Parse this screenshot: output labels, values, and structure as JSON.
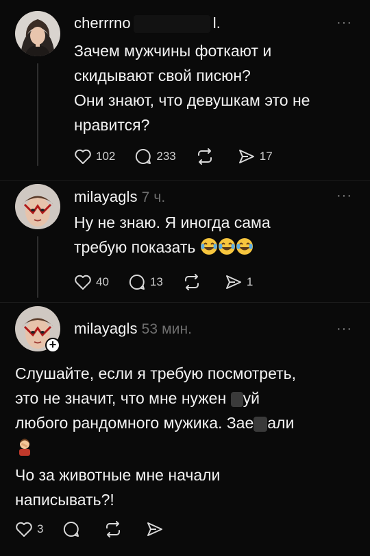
{
  "post1": {
    "username": "cherrrno",
    "username_tail": "l.",
    "text_lines": [
      "Зачем мужчины фоткают и",
      "скидывают свой писюн?",
      "Они знают, что девушкам это не",
      "нравится?"
    ],
    "likes": "102",
    "comments": "233",
    "shares": "17",
    "more": "···"
  },
  "post2": {
    "username": "milayagls",
    "time": "7 ч.",
    "text_lines": [
      "Ну не знаю. Я иногда сама",
      "требую показать"
    ],
    "likes": "40",
    "comments": "13",
    "shares": "1",
    "more": "···"
  },
  "post3": {
    "username": "milayagls",
    "time": "53 мин.",
    "text_lines": [
      "Слушайте, если я требую посмотреть,",
      "это не значит, что мне нужен ",
      "любого рандомного мужика. Зае",
      "Чо за животные мне начали",
      "написывать?!"
    ],
    "line2_tail": "уй",
    "line3_tail": "али",
    "likes": "3",
    "more": "···"
  },
  "icons": {
    "like": "heart-icon",
    "comment": "comment-bubble-icon",
    "repost": "repost-icon",
    "share": "send-icon",
    "more": "more-dots-icon",
    "follow": "plus-icon",
    "emoji_laugh": "face-with-tears-of-joy",
    "emoji_facepalm": "woman-facepalming"
  }
}
